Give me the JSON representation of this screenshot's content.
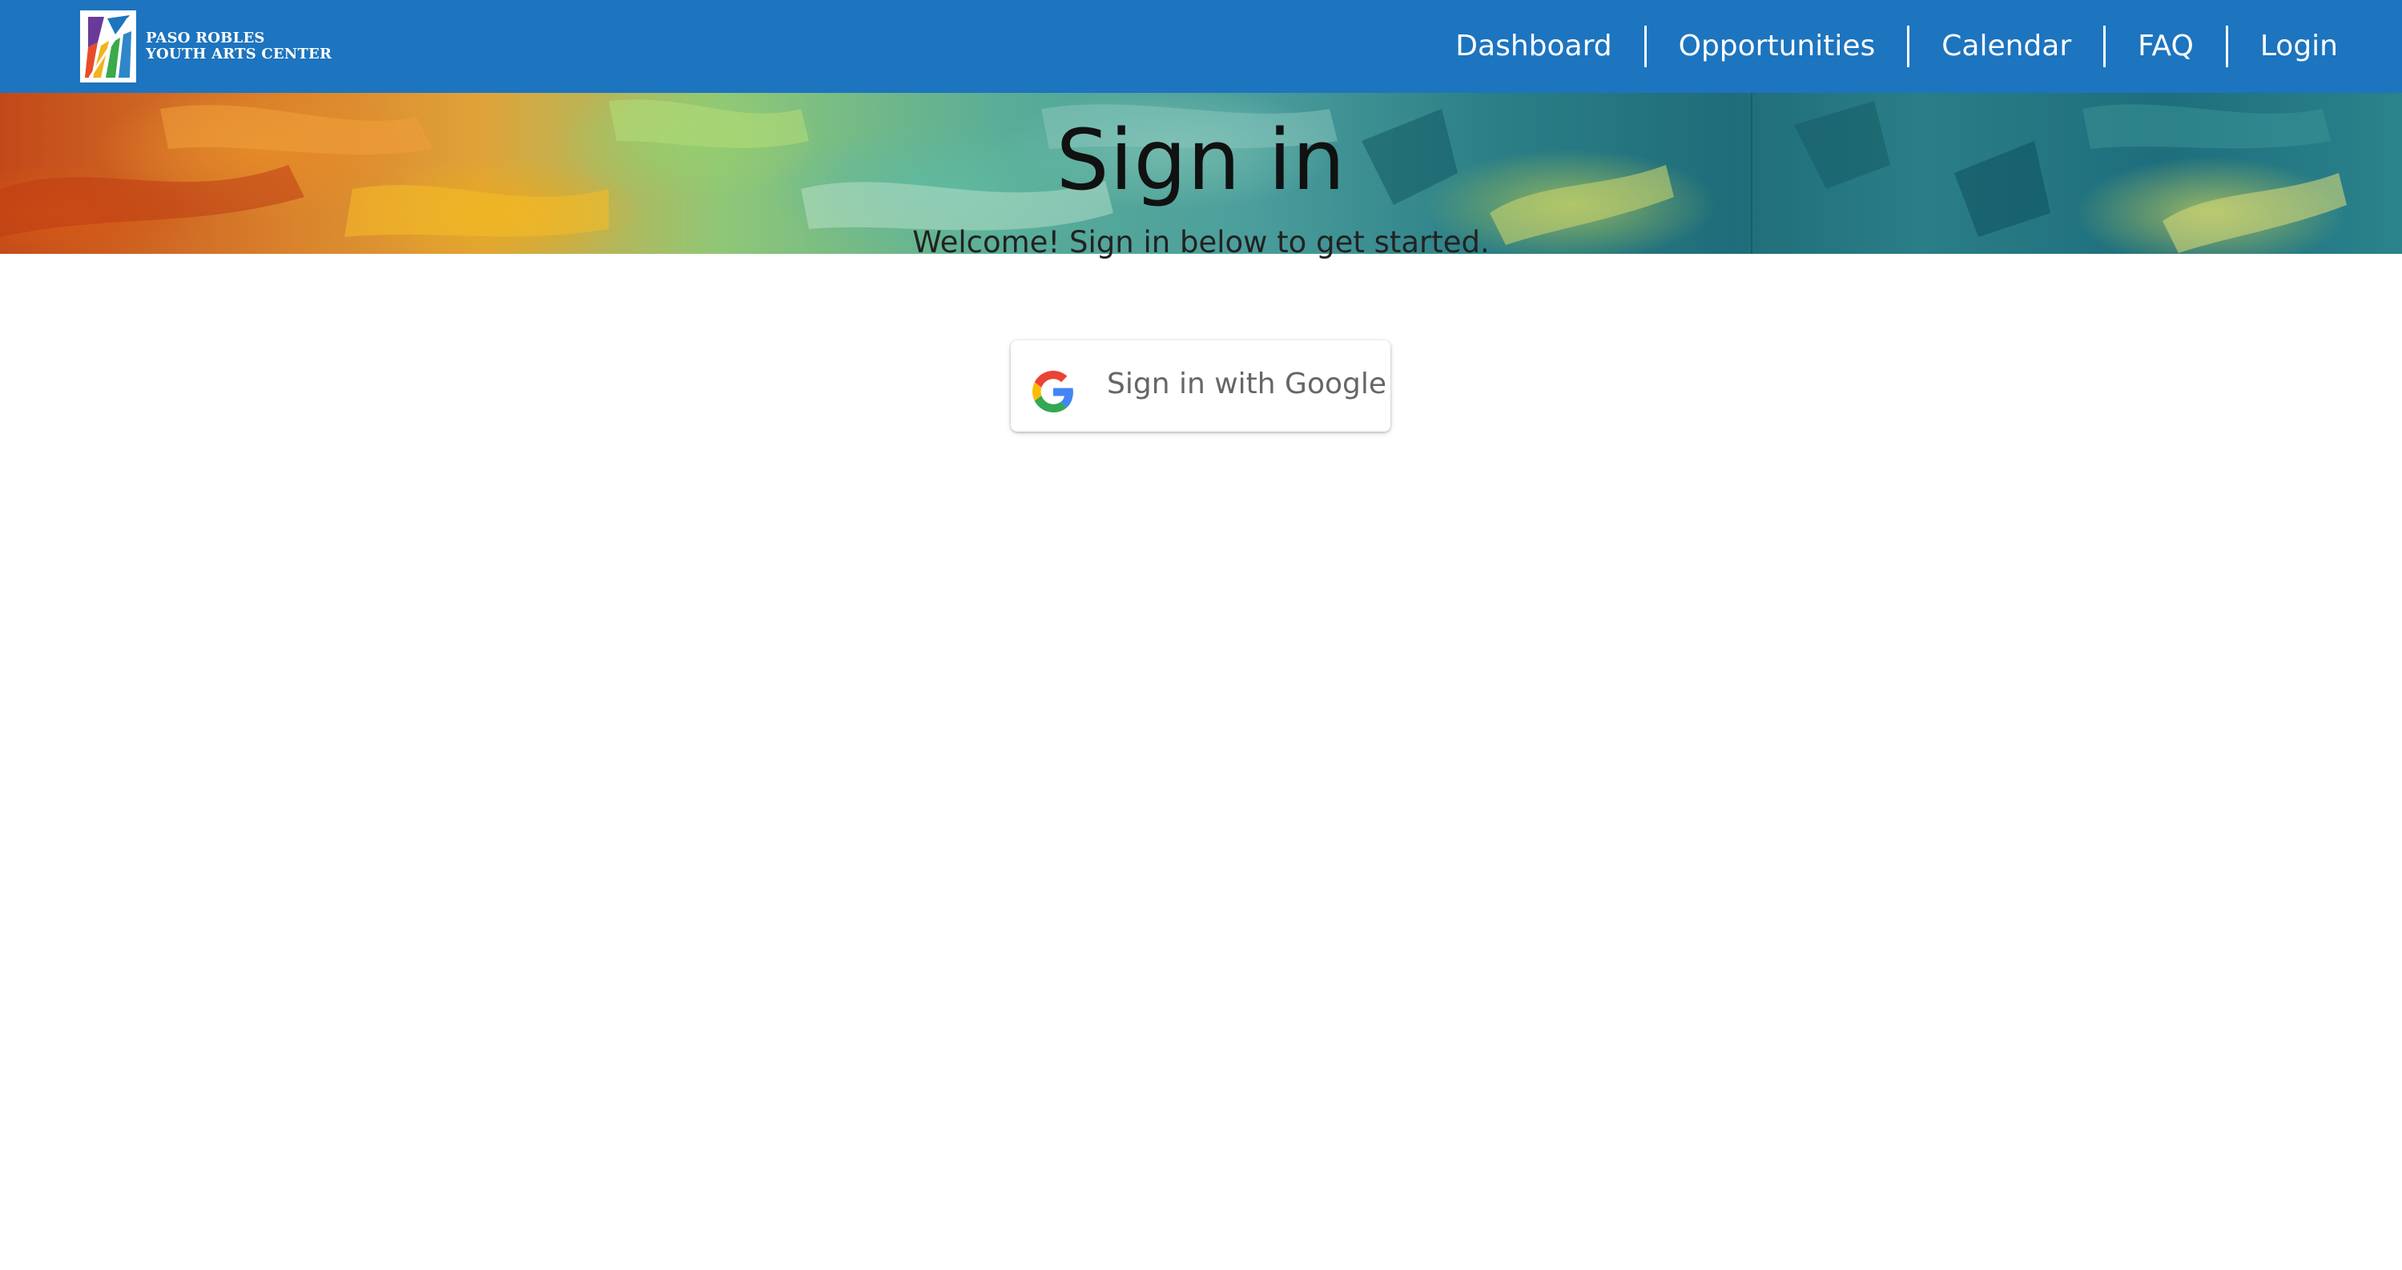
{
  "brand": {
    "line1": "PASO ROBLES",
    "line2": "YOUTH ARTS CENTER",
    "logo_icon": "paso-robles-youth-arts-logo",
    "color_header": "#1d74bf"
  },
  "nav": {
    "items": [
      {
        "label": "Dashboard"
      },
      {
        "label": "Opportunities"
      },
      {
        "label": "Calendar"
      },
      {
        "label": "FAQ"
      },
      {
        "label": "Login"
      }
    ]
  },
  "banner": {
    "image": "abstract-painting-banner"
  },
  "main": {
    "title": "Sign in",
    "subtitle": "Welcome! Sign in below to get started.",
    "google_button": {
      "label": "Sign in with Google",
      "icon": "google-g-icon"
    }
  }
}
